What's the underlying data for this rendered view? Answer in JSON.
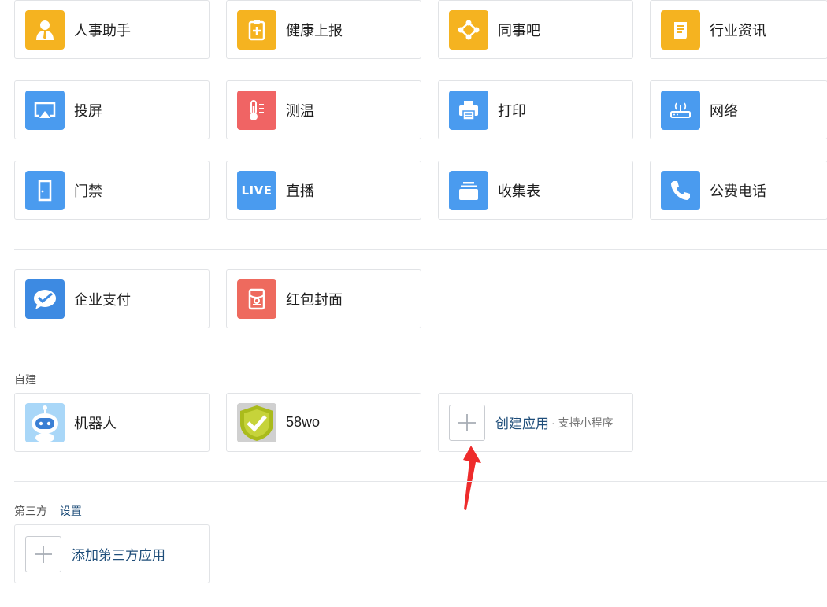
{
  "apps_row1": [
    {
      "label": "人事助手",
      "icon": "person-tie-icon",
      "color": "#f5b320"
    },
    {
      "label": "健康上报",
      "icon": "clipboard-plus-icon",
      "color": "#f5b320"
    },
    {
      "label": "同事吧",
      "icon": "network-icon",
      "color": "#f5b320"
    },
    {
      "label": "行业资讯",
      "icon": "news-scroll-icon",
      "color": "#f5b320"
    }
  ],
  "apps_row2": [
    {
      "label": "投屏",
      "icon": "screencast-icon",
      "color": "#4a9bef"
    },
    {
      "label": "测温",
      "icon": "thermometer-icon",
      "color": "#f06464"
    },
    {
      "label": "打印",
      "icon": "printer-icon",
      "color": "#4a9bef"
    },
    {
      "label": "网络",
      "icon": "router-icon",
      "color": "#4a9bef"
    }
  ],
  "apps_row3": [
    {
      "label": "门禁",
      "icon": "door-icon",
      "color": "#4a9bef"
    },
    {
      "label": "直播",
      "icon": "live-icon",
      "icon_text": "LIVE",
      "color": "#4a9bef"
    },
    {
      "label": "收集表",
      "icon": "form-stack-icon",
      "color": "#4a9bef"
    },
    {
      "label": "公费电话",
      "icon": "phone-icon",
      "color": "#4a9bef"
    }
  ],
  "apps_payment": [
    {
      "label": "企业支付",
      "icon": "wechat-pay-icon",
      "color": "#3d8ae2"
    },
    {
      "label": "红包封面",
      "icon": "red-envelope-icon",
      "color": "#ee6a5e"
    }
  ],
  "self_built": {
    "section_label": "自建",
    "apps": [
      {
        "label": "机器人",
        "icon": "robot-icon"
      },
      {
        "label": "58wo",
        "icon": "shield-check-icon"
      }
    ],
    "create": {
      "label": "创建应用",
      "sub": "· 支持小程序"
    }
  },
  "third_party": {
    "section_label": "第三方",
    "settings_link": "设置",
    "add_label": "添加第三方应用"
  },
  "colors": {
    "link": "#1f4e7a",
    "arrow": "#ee2b2b",
    "border": "#e1e3e6"
  }
}
